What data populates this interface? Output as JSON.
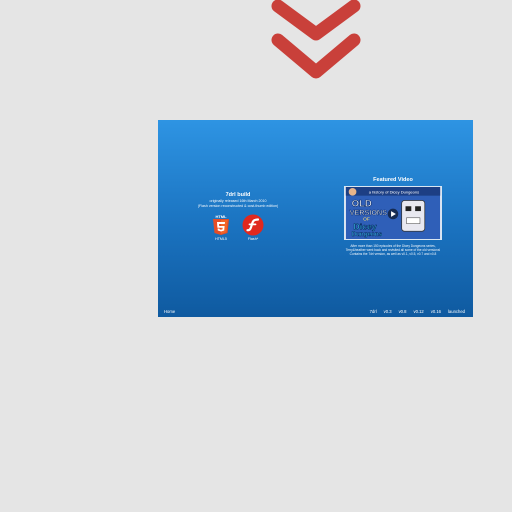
{
  "page": {
    "accent_color": "#c9403a",
    "background": "#e5e5e5"
  },
  "scroll_hint": {
    "icon": "double-chevron-down-icon"
  },
  "panel": {
    "gradient_top": "#2e94e3",
    "gradient_bottom": "#0f5aa0",
    "build": {
      "title": "7drl build",
      "released": "originally released 16th March 2010",
      "note": "(Flash version reconstructed & cost-thumb edition)",
      "platforms": [
        {
          "label": "HTML5",
          "icon": "html5-icon"
        },
        {
          "label": "Flash*",
          "icon": "flash-icon"
        }
      ]
    },
    "video": {
      "heading": "Featured Video",
      "thumb_text_1": "OLD",
      "thumb_text_2": "VERSIONS",
      "thumb_text_3": "OF",
      "thumb_text_4": "Dicey",
      "thumb_text_5": "Dungeons",
      "thumb_caption": "a history of Dicey Dungeons",
      "description": [
        "After more than 150 episodes of the Dicey Dungeons series,",
        "Terry&heather went back and revisited all some of the old versions!",
        "Contains the 7drl version, as well as v0.1, v0.5, v0.7 and v0.8"
      ]
    },
    "footer": {
      "home": "Home",
      "versions": [
        "7drl",
        "v0.3",
        "v0.8",
        "v0.12",
        "v0.16",
        "launched"
      ]
    }
  }
}
